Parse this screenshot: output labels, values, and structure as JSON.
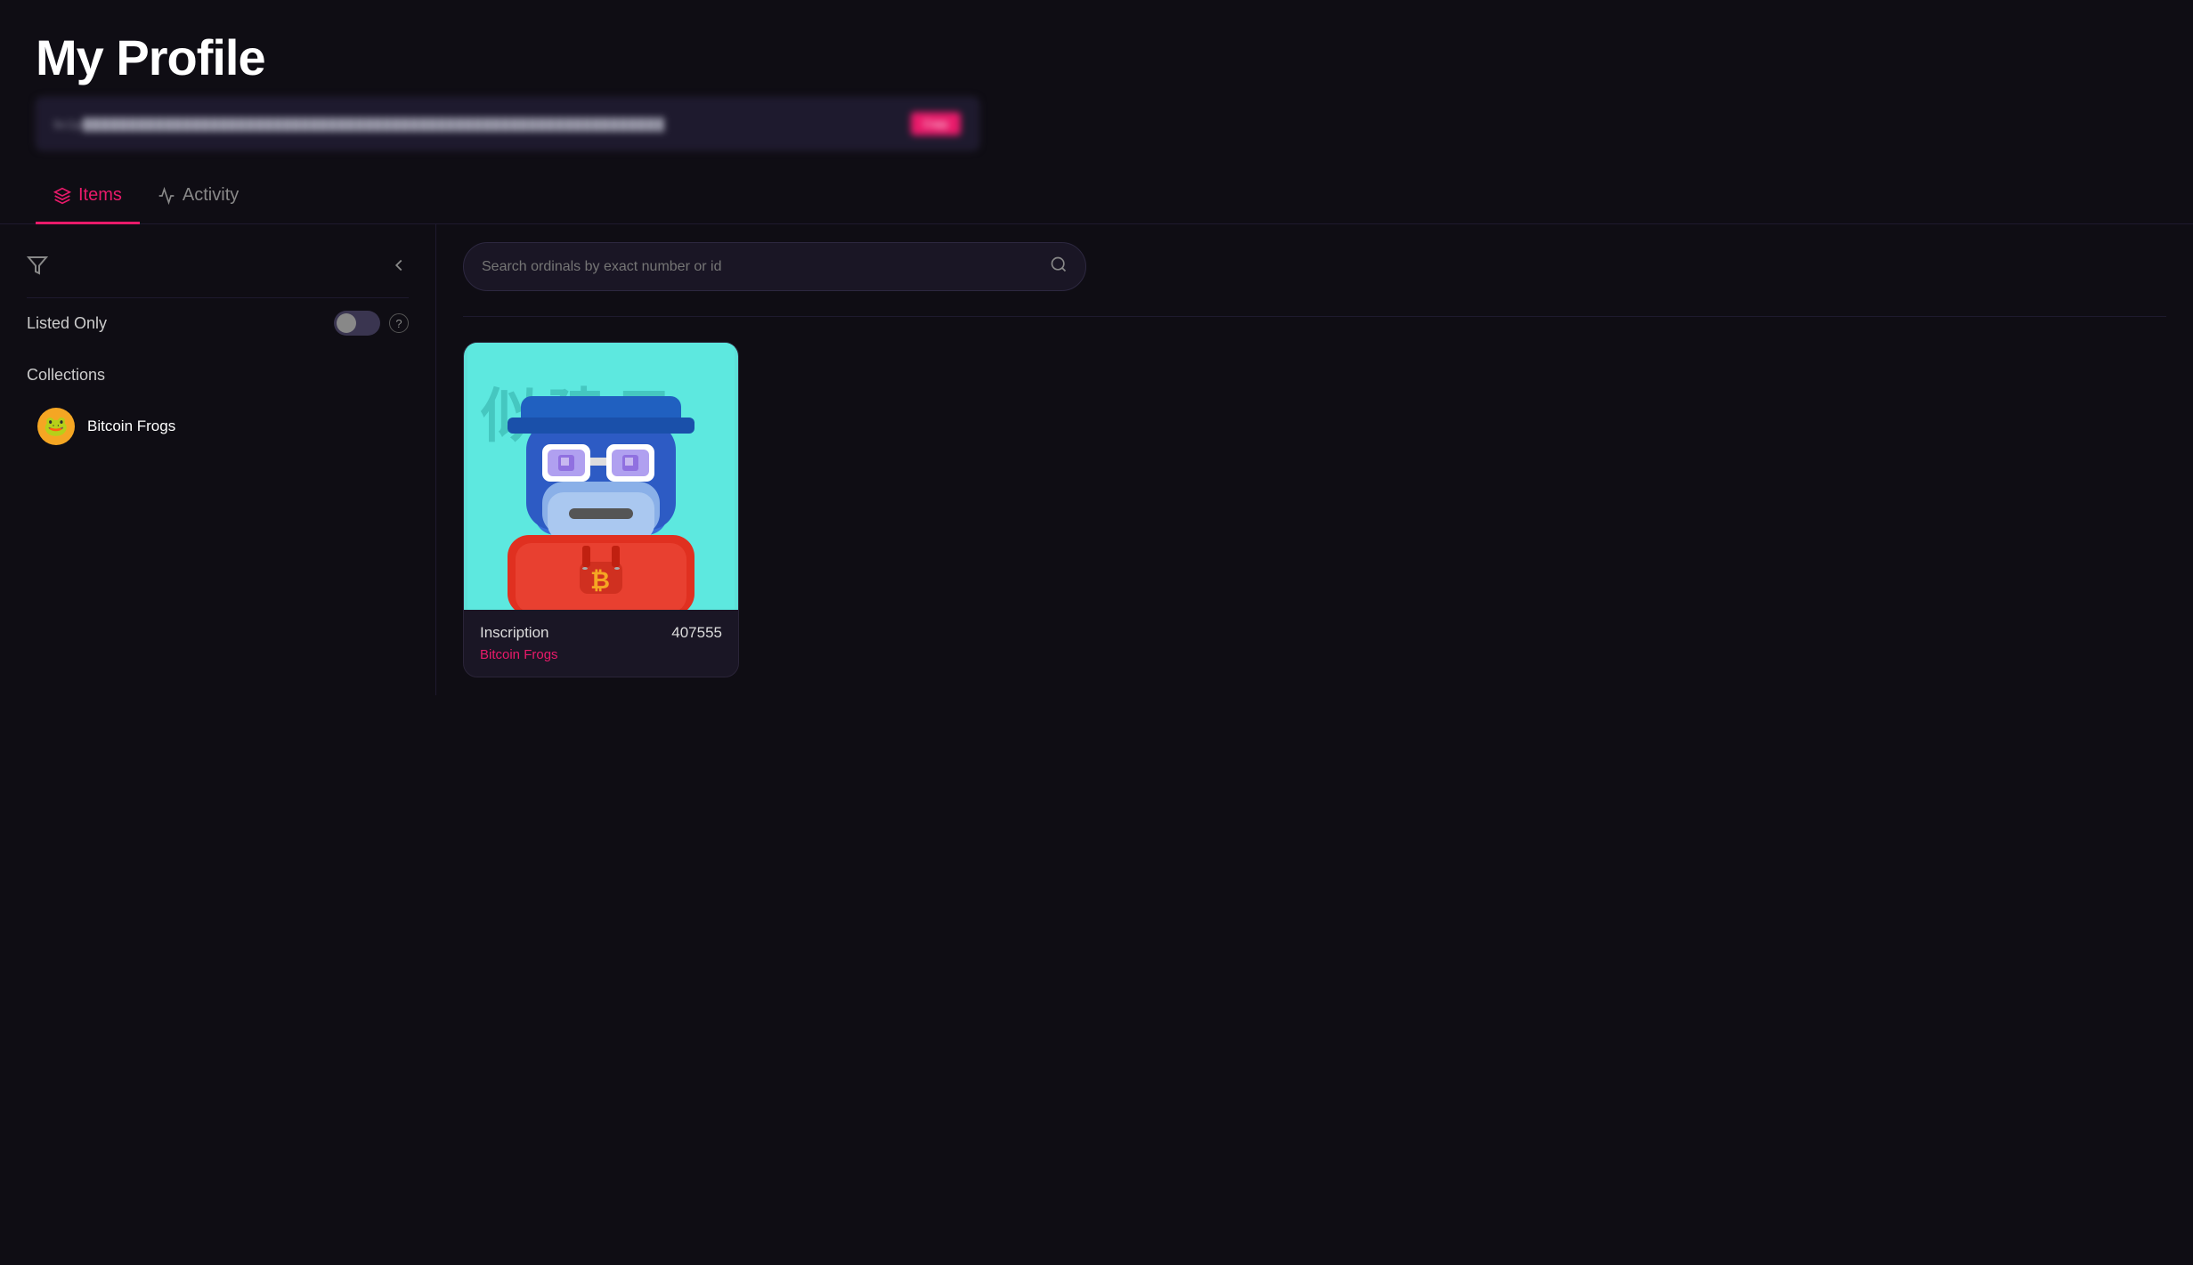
{
  "header": {
    "title": "My Profile",
    "address_placeholder": "bc1p...redacted...address...shown...here"
  },
  "tabs": [
    {
      "id": "items",
      "label": "Items",
      "active": true
    },
    {
      "id": "activity",
      "label": "Activity",
      "active": false
    }
  ],
  "sidebar": {
    "filter_label": "Listed Only",
    "collections_title": "Collections",
    "collections": [
      {
        "name": "Bitcoin Frogs",
        "emoji": "🐸"
      }
    ]
  },
  "search": {
    "placeholder": "Search ordinals by exact number or id"
  },
  "nft_cards": [
    {
      "label": "Inscription",
      "number": "407555",
      "collection": "Bitcoin Frogs"
    }
  ],
  "colors": {
    "accent": "#e91a6a",
    "background": "#0f0d14",
    "card_bg": "#1a1625",
    "border": "#2d2840"
  }
}
